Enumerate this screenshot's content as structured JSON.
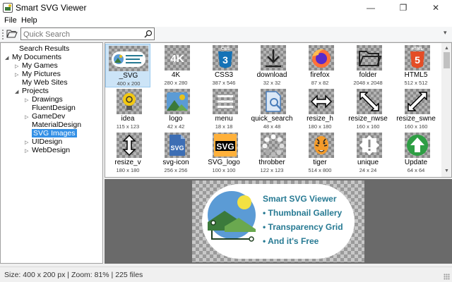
{
  "window": {
    "title": "Smart SVG Viewer",
    "minimize": "—",
    "maximize": "❐",
    "close": "✕"
  },
  "menu": {
    "file": "File",
    "help": "Help"
  },
  "toolbar": {
    "search_placeholder": "Quick Search",
    "overflow": "▾"
  },
  "tree": {
    "items": [
      {
        "label": "Search Results",
        "arrow": ""
      },
      {
        "label": "My Documents",
        "arrow": "◢"
      },
      {
        "label": "My Games",
        "arrow": "▷"
      },
      {
        "label": "My Pictures",
        "arrow": "▷"
      },
      {
        "label": "My Web Sites",
        "arrow": ""
      },
      {
        "label": "Projects",
        "arrow": "◢"
      },
      {
        "label": "Drawings",
        "arrow": "▷"
      },
      {
        "label": "FluentDesign",
        "arrow": ""
      },
      {
        "label": "GameDev",
        "arrow": "▷"
      },
      {
        "label": "MaterialDesign",
        "arrow": ""
      },
      {
        "label": "SVG Images",
        "arrow": ""
      },
      {
        "label": "UIDesign",
        "arrow": "▷"
      },
      {
        "label": "WebDesign",
        "arrow": "▷"
      }
    ]
  },
  "gallery": {
    "items": [
      {
        "name": "_SVG",
        "size": "400 x 200",
        "icon": "badge-icon"
      },
      {
        "name": "4K",
        "size": "280 x 280",
        "icon": "4k-icon"
      },
      {
        "name": "CSS3",
        "size": "387 x 546",
        "icon": "css3-icon"
      },
      {
        "name": "download",
        "size": "32 x 32",
        "icon": "download-icon"
      },
      {
        "name": "firefox",
        "size": "87 x 82",
        "icon": "firefox-icon"
      },
      {
        "name": "folder",
        "size": "2048 x 2048",
        "icon": "folder-icon"
      },
      {
        "name": "HTML5",
        "size": "512 x 512",
        "icon": "html5-icon"
      },
      {
        "name": "idea",
        "size": "115 x 123",
        "icon": "lightbulb-icon"
      },
      {
        "name": "logo",
        "size": "42 x 42",
        "icon": "logo-icon"
      },
      {
        "name": "menu",
        "size": "18 x 18",
        "icon": "menu-icon"
      },
      {
        "name": "quick_search",
        "size": "48 x 48",
        "icon": "document-search-icon"
      },
      {
        "name": "resize_h",
        "size": "180 x 180",
        "icon": "resize-horizontal-icon"
      },
      {
        "name": "resize_nwse",
        "size": "160 x 160",
        "icon": "resize-nwse-icon"
      },
      {
        "name": "resize_swne",
        "size": "160 x 160",
        "icon": "resize-swne-icon"
      },
      {
        "name": "resize_v",
        "size": "180 x 180",
        "icon": "resize-vertical-icon"
      },
      {
        "name": "svg-icon",
        "size": "256 x 256",
        "icon": "svg-file-icon"
      },
      {
        "name": "SVG_logo",
        "size": "100 x 100",
        "icon": "svg-logo-icon"
      },
      {
        "name": "throbber",
        "size": "122 x 123",
        "icon": "throbber-icon"
      },
      {
        "name": "tiger",
        "size": "514 x 800",
        "icon": "tiger-icon"
      },
      {
        "name": "unique",
        "size": "24 x 24",
        "icon": "unique-icon"
      },
      {
        "name": "Update",
        "size": "64 x 64",
        "icon": "update-icon"
      }
    ],
    "labels": {
      "k4": "4K",
      "css": "CSS",
      "html": "HTML",
      "svg": "SVG"
    }
  },
  "preview": {
    "lines": [
      "Smart SVG Viewer",
      "• Thumbnail Gallery",
      "• Transparency Grid",
      "• And it's Free"
    ]
  },
  "status": {
    "text": "Size: 400 x 200 px | Zoom: 81% | 225 files"
  },
  "colors": {
    "accent": "#3390e6",
    "preview_text": "#277a93",
    "green": "#3b7a3b",
    "sun": "#e8c21a"
  }
}
